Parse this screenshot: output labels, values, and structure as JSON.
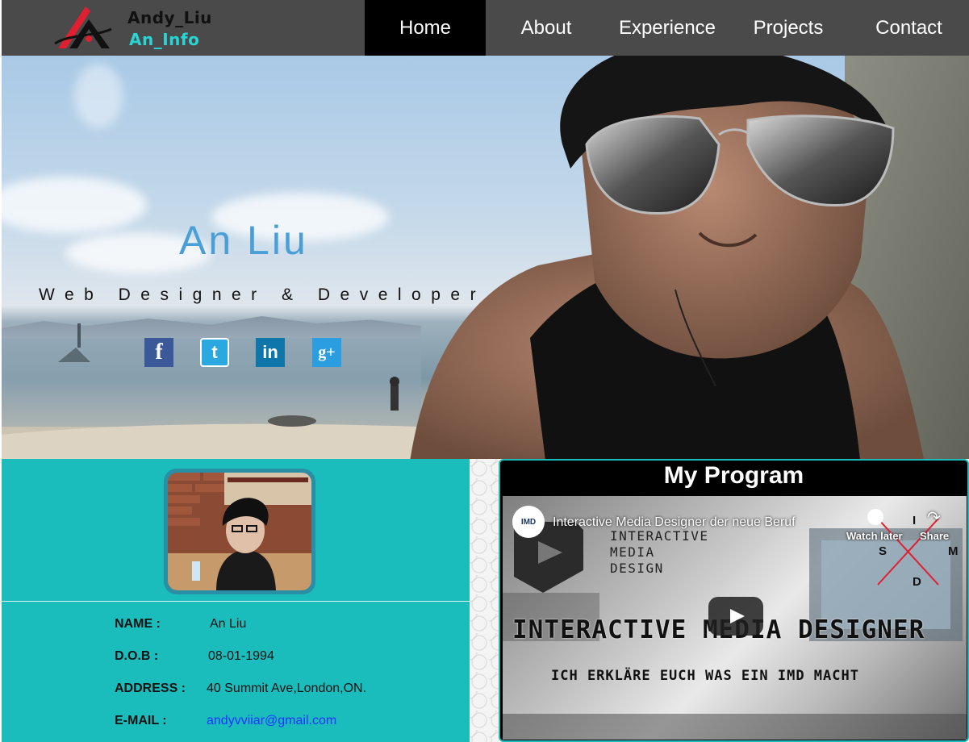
{
  "logo": {
    "name": "Andy_Liu",
    "sub": "An_Info"
  },
  "nav": {
    "items": [
      {
        "label": "Home"
      },
      {
        "label": "About"
      },
      {
        "label": "Experience"
      },
      {
        "label": "Projects"
      },
      {
        "label": "Contact"
      }
    ],
    "active": "Home"
  },
  "hero": {
    "name": "An Liu",
    "role": "Web Designer & Developer",
    "social": [
      {
        "icon": "facebook-icon",
        "glyph": "f",
        "color": "#3b5998"
      },
      {
        "icon": "twitter-icon",
        "glyph": "t",
        "color": "#2aa9e0"
      },
      {
        "icon": "linkedin-icon",
        "glyph": "in",
        "color": "#0e76a8"
      },
      {
        "icon": "googleplus-icon",
        "glyph": "g+",
        "color": "#2a9ee0"
      }
    ]
  },
  "profile": {
    "rows": [
      {
        "label": "NAME :",
        "value": "An Liu"
      },
      {
        "label": "D.O.B :",
        "value": "08-01-1994"
      },
      {
        "label": "ADDRESS :",
        "value": "40 Summit Ave,London,ON."
      },
      {
        "label": "E-MAIL :",
        "value": "andyvviiar@gmail.com"
      }
    ]
  },
  "program": {
    "title": "My Program",
    "video": {
      "title": "Interactive Media Designer der neue Beruf",
      "watch_later": "Watch later",
      "share": "Share",
      "logo_lines": [
        "INTERACTIVE",
        "MEDIA",
        "DESIGN"
      ],
      "headline": "INTERACTIVE MEDIA DESIGNER",
      "subline": "ICH ERKLÄRE EUCH WAS EIN IMD MACHT",
      "smid": {
        "i": "I",
        "s": "S",
        "m": "M",
        "d": "D"
      }
    }
  },
  "colors": {
    "nav_bg": "#4a4a4a",
    "nav_active": "#000000",
    "teal": "#1bbcbc",
    "accent_name": "#4a9fd6",
    "link": "#1a33ff"
  }
}
